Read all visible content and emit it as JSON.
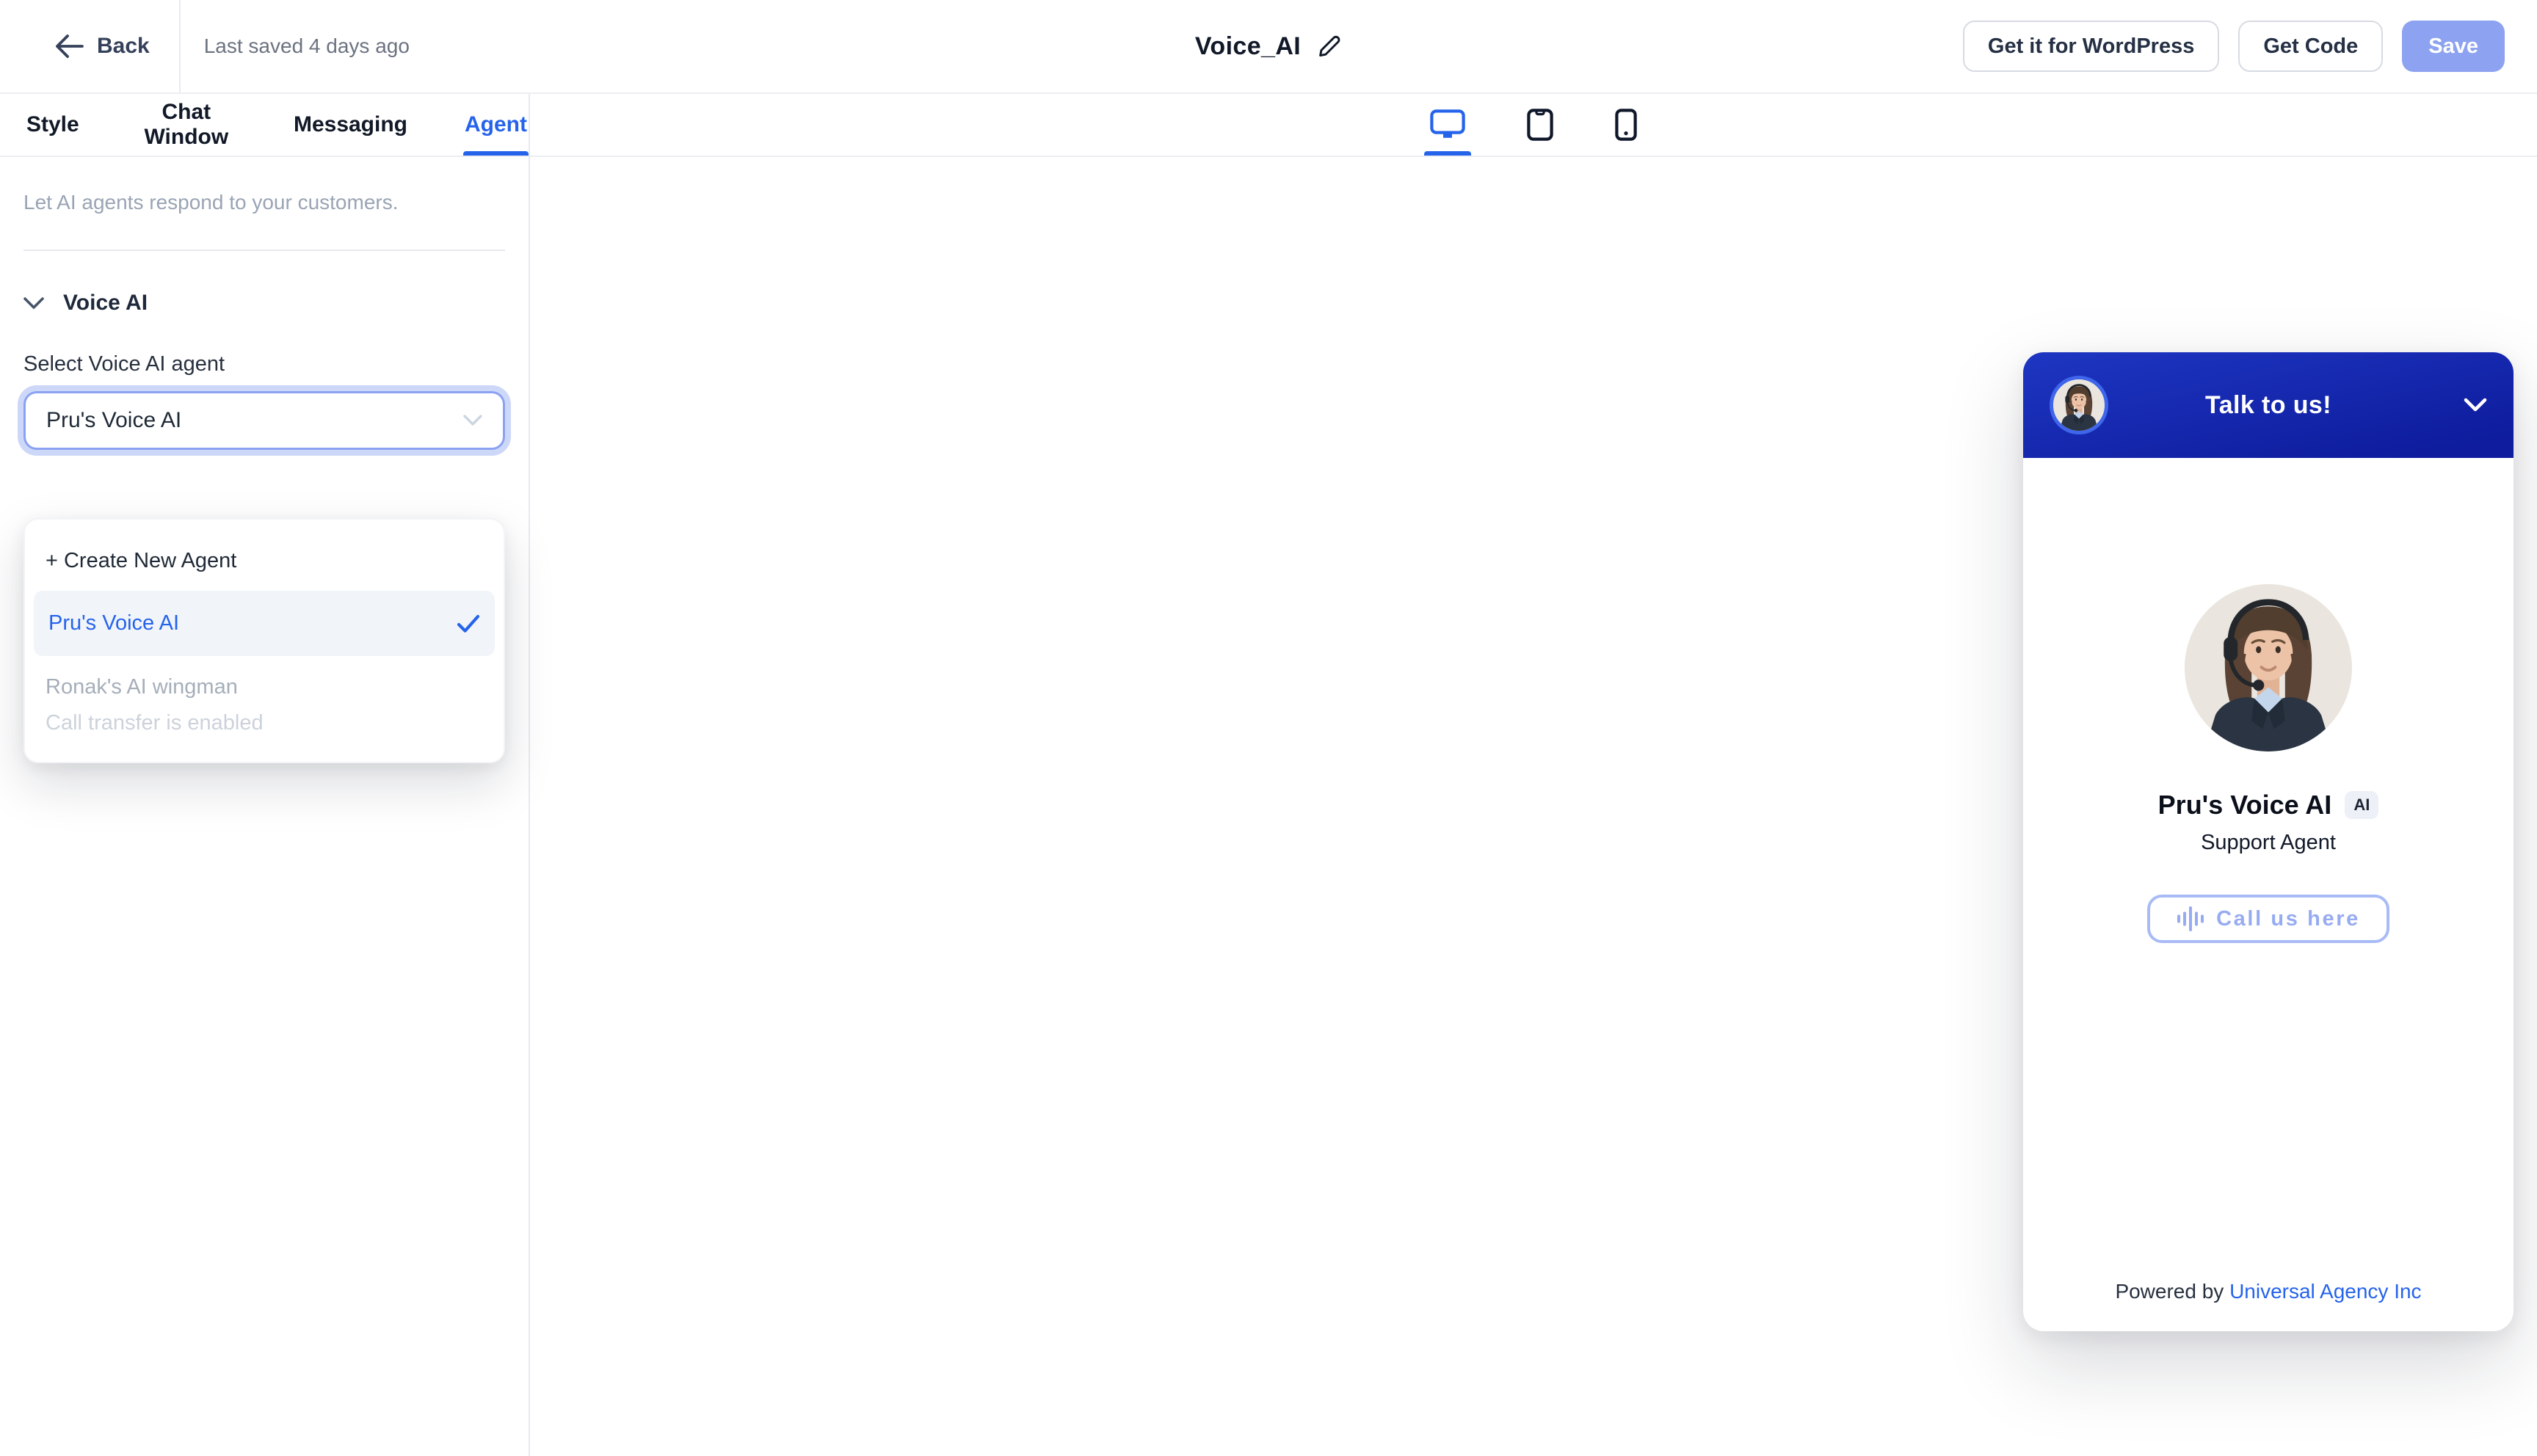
{
  "topbar": {
    "back_label": "Back",
    "last_saved": "Last saved 4 days ago",
    "title": "Voice_AI",
    "buttons": {
      "wordpress": "Get it for WordPress",
      "get_code": "Get Code",
      "save": "Save"
    }
  },
  "tabs": [
    {
      "label": "Style",
      "active": false
    },
    {
      "label": "Chat Window",
      "active": false
    },
    {
      "label": "Messaging",
      "active": false
    },
    {
      "label": "Agent",
      "active": true
    }
  ],
  "sidebar": {
    "description": "Let AI agents respond to your customers.",
    "section_title": "Voice AI",
    "select_label": "Select Voice AI agent",
    "select_value": "Pru's Voice AI",
    "dropdown": {
      "create_new": "+ Create New Agent",
      "options": [
        {
          "name": "Pru's Voice AI",
          "selected": true
        },
        {
          "name": "Ronak's AI wingman",
          "subtitle": "Call transfer is enabled",
          "disabled": true
        }
      ]
    }
  },
  "preview": {
    "active_device": "desktop",
    "devices": [
      "desktop",
      "tablet",
      "mobile"
    ]
  },
  "widget": {
    "header_title": "Talk to us!",
    "agent_name": "Pru's Voice AI",
    "ai_badge": "AI",
    "agent_role": "Support Agent",
    "call_button_label": "Call us here",
    "powered_by_label": "Powered by ",
    "company_link": "Universal Agency Inc"
  },
  "colors": {
    "accent_blue": "#2563eb",
    "widget_header_blue": "#14239f",
    "save_button": "#8da2f0",
    "call_button_blue": "#97abf1",
    "link_blue": "#2563eb"
  }
}
